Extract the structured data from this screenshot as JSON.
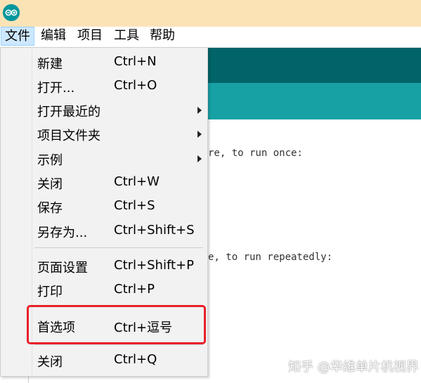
{
  "menubar": {
    "items": [
      {
        "label": "文件",
        "active": true
      },
      {
        "label": "编辑"
      },
      {
        "label": "项目"
      },
      {
        "label": "工具"
      },
      {
        "label": "帮助"
      }
    ]
  },
  "file_menu": {
    "items": [
      {
        "label": "新建",
        "shortcut": "Ctrl+N"
      },
      {
        "label": "打开...",
        "shortcut": "Ctrl+O"
      },
      {
        "label": "打开最近的",
        "shortcut": "",
        "submenu": true
      },
      {
        "label": "项目文件夹",
        "shortcut": "",
        "submenu": true
      },
      {
        "label": "示例",
        "shortcut": "",
        "submenu": true
      },
      {
        "label": "关闭",
        "shortcut": "Ctrl+W"
      },
      {
        "label": "保存",
        "shortcut": "Ctrl+S"
      },
      {
        "label": "另存为...",
        "shortcut": "Ctrl+Shift+S"
      },
      {
        "label": "页面设置",
        "shortcut": "Ctrl+Shift+P"
      },
      {
        "label": "打印",
        "shortcut": "Ctrl+P"
      },
      {
        "label": "首选项",
        "shortcut": "Ctrl+逗号",
        "highlighted": true
      },
      {
        "label": "关闭",
        "shortcut": "Ctrl+Q"
      }
    ]
  },
  "editor": {
    "lines": [
      "re, to run once:",
      "e, to run repeatedly:"
    ]
  },
  "watermark": "知乎 @华维单片机视界",
  "colors": {
    "titlebar": "#fce3b6",
    "toolbar": "#006468",
    "tabs": "#17a1a5",
    "highlight": "#e8202a",
    "menu_bg": "#f2f2f2"
  },
  "icons": {
    "app": "arduino-logo-icon",
    "submenu": "chevron-right-icon"
  }
}
